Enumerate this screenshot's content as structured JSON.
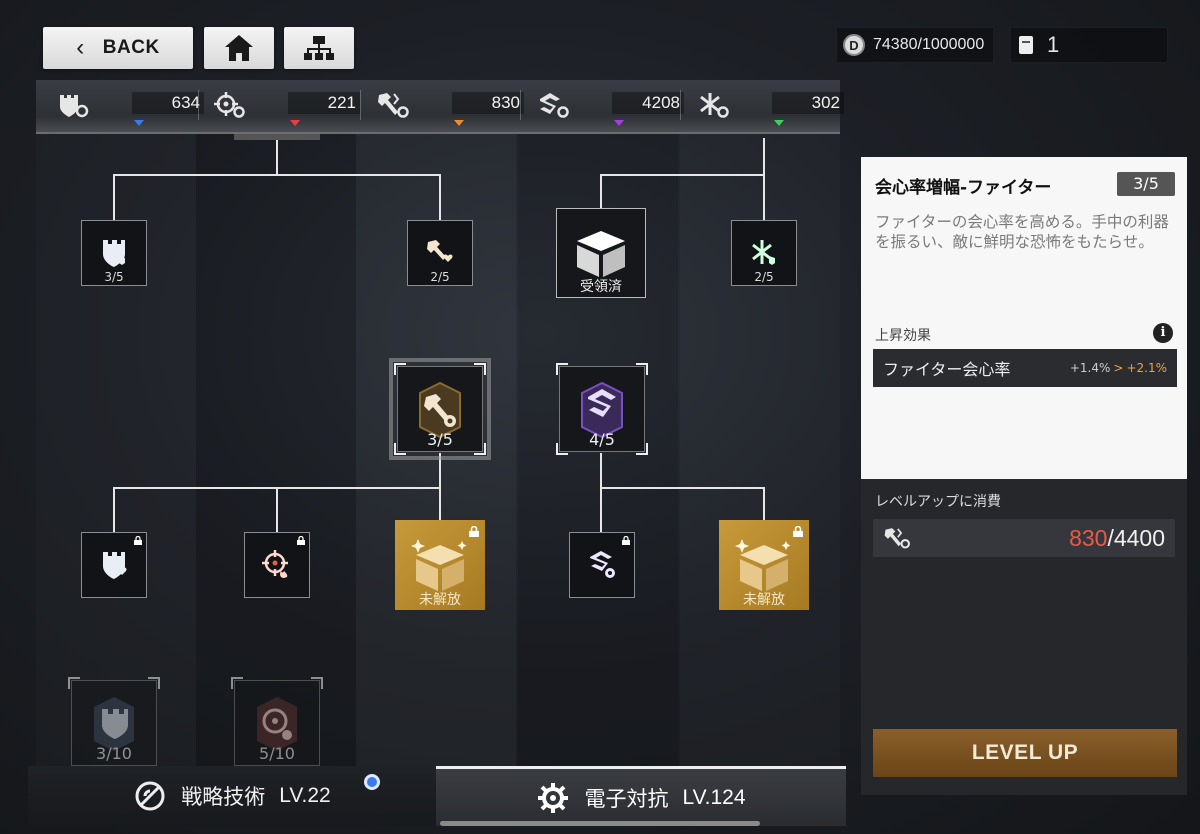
{
  "header": {
    "back_label": "BACK",
    "home_icon": "home-icon",
    "tree_icon": "tree-icon"
  },
  "resources": {
    "coin_value": "74380/1000000",
    "book_value": "1"
  },
  "stats": [
    {
      "icon": "tank-stat-icon",
      "value": "634",
      "color": "#3d7be8"
    },
    {
      "icon": "crosshair-stat-icon",
      "value": "221",
      "color": "#e84040"
    },
    {
      "icon": "fighter-stat-icon",
      "value": "830",
      "color": "#f08a30"
    },
    {
      "icon": "electronic-stat-icon",
      "value": "4208",
      "color": "#a040e0"
    },
    {
      "icon": "support-stat-icon",
      "value": "302",
      "color": "#40d060"
    }
  ],
  "nodes": {
    "row1": [
      {
        "level": "3/5"
      },
      {
        "level": "2/5"
      },
      {
        "level": "受領済"
      },
      {
        "level": "2/5"
      }
    ],
    "row2": [
      {
        "level": "3/5"
      },
      {
        "level": "4/5"
      }
    ],
    "row3": [
      {
        "level": ""
      },
      {
        "level": ""
      },
      {
        "level": "未解放"
      },
      {
        "level": ""
      },
      {
        "level": "未解放"
      }
    ],
    "row4": [
      {
        "level": "3/10"
      },
      {
        "level": "5/10"
      }
    ]
  },
  "panel": {
    "title": "会心率増幅-ファイター",
    "badge": "3/5",
    "description": "ファイターの会心率を高める。手中の利器を振るい、敵に鮮明な恐怖をもたらせ。",
    "effect_label": "上昇効果",
    "effect_name": "ファイター会心率",
    "effect_old": "+1.4%",
    "effect_arrow": ">",
    "effect_new": "+2.1%",
    "cost_label": "レベルアップに消費",
    "cost_have": "830",
    "cost_need": "/4400",
    "level_up": "LEVEL UP"
  },
  "bottom_tabs": [
    {
      "label": "戦略技術",
      "level": "LV.22"
    },
    {
      "label": "電子対抗",
      "level": "LV.124"
    }
  ]
}
